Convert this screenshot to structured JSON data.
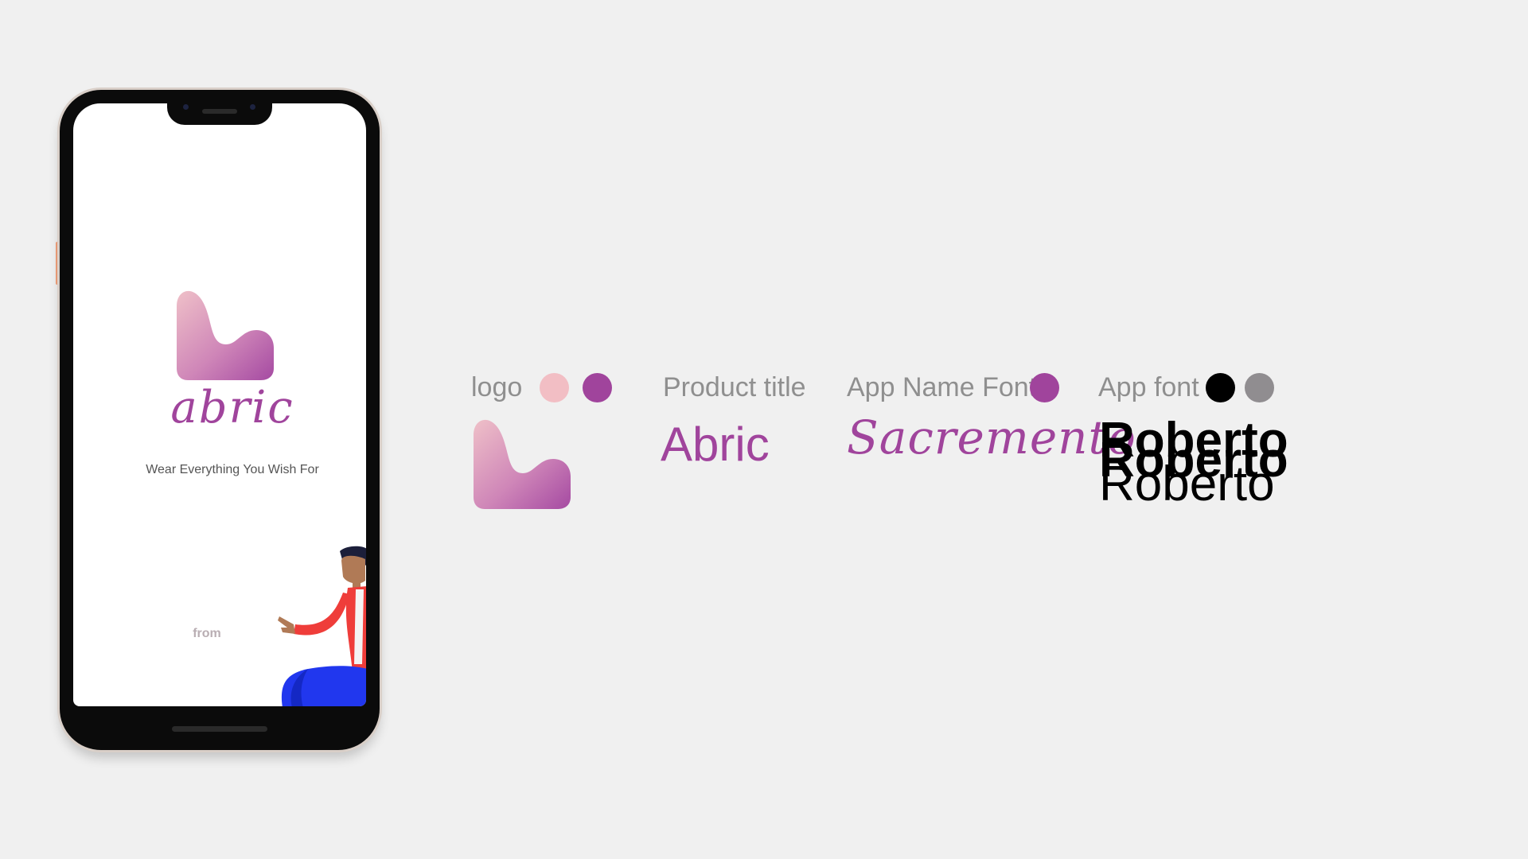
{
  "phone_screen": {
    "app_name": "abric",
    "tagline": "Wear Everything You Wish For",
    "from_label": "from"
  },
  "style_guide": {
    "logo": {
      "label": "logo",
      "colors": [
        "#f2bec4",
        "#a0449c"
      ]
    },
    "product_title": {
      "label": "Product title",
      "sample": "Abric",
      "color": "#a0449c"
    },
    "app_name_font": {
      "label": "App Name Font",
      "sample": "Sacremento",
      "color": "#a0449c"
    },
    "app_font": {
      "label": "App font",
      "samples": [
        "Roberto",
        "Roberto",
        "Roberto"
      ],
      "colors": [
        "#000000",
        "#908d90"
      ]
    }
  },
  "icons": [
    "abric-logo-icon",
    "person-illustration"
  ]
}
